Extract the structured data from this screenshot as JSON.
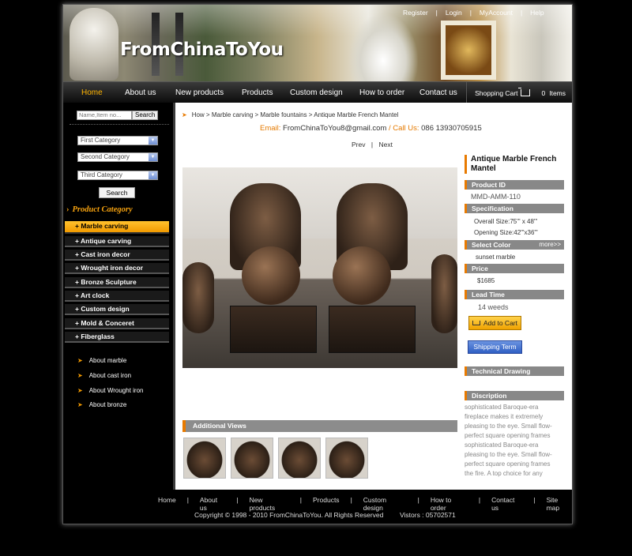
{
  "header": {
    "logo": "FromChinaToYou",
    "top_links": [
      "Register",
      "Login",
      "MyAccount",
      "Help"
    ]
  },
  "nav": {
    "items": [
      "Home",
      "About us",
      "New products",
      "Products",
      "Custom design",
      "How to order",
      "Contact us"
    ],
    "active": "Home",
    "cart_label": "Shopping Cart",
    "cart_count": "0",
    "cart_items_label": "Items"
  },
  "sidebar": {
    "search_placeholder": "Name,Item no...",
    "search_button": "Search",
    "selects": [
      "First Category",
      "Second Category",
      "Third Category"
    ],
    "search_button2": "Search",
    "category_title": "Product Category",
    "categories": [
      "Marble carving",
      "Antique carving",
      "Cast iron decor",
      "Wrought iron decor",
      "Bronze Sculpture",
      "Art clock",
      "Custom design",
      "Mold & Conceret",
      "Fiberglass"
    ],
    "about_links": [
      "About marble",
      "About cast iron",
      "About Wrought iron",
      "About bronze"
    ]
  },
  "main": {
    "breadcrumb": "How > Marble carving > Marble fountains > Antique Marble French Mantel",
    "email_label": "Email:",
    "email": "FromChinaToYou8@gmail.com",
    "slash": "/",
    "phone_label": "Call Us:",
    "phone": "086  13930705915",
    "prev": "Prev",
    "pager_sep": "|",
    "next": "Next",
    "additional_views": "Additional Views"
  },
  "product": {
    "title": "Antique Marble French Mantel",
    "id_label": "Product ID",
    "id": "MMD-AMM-110",
    "spec_label": "Specification",
    "overall_size": "Overall Size:75\"' x 48\"'",
    "opening_size": "Opening Size:42\"'x36\"'",
    "color_label": "Select Color",
    "more": "more>>",
    "color": "sunset marble",
    "price_label": "Price",
    "price": "$1685",
    "lead_label": "Lead Time",
    "lead": "14 weeds",
    "add_to_cart": "Add to Cart",
    "shipping": "Shipping Term",
    "tech_drawing": "Technical Drawing",
    "desc_label": "Discription",
    "description_lines": [
      "sophisticated Baroque-era",
      "fireplace makes it extremely",
      "pleasing to the eye. Small flow-",
      "perfect square opening frames",
      "sophisticated Baroque-era",
      "pleasing to the eye. Small flow-",
      "perfect square opening frames",
      "the fire. A top choice for any"
    ]
  },
  "footer": {
    "links": [
      "Home",
      "About us",
      "New products",
      "Products",
      "Custom design",
      "How to order",
      "Contact us",
      "Site map"
    ],
    "copyright": "Copyright © 1998 - 2010 FromChinaToYou. All Rights Reserved",
    "visitors": "Vistors : 05702571"
  },
  "colors": {
    "accent": "#e87a00",
    "active_cat": "#f6a20f",
    "ship_btn": "#2f5fc4",
    "background": "#000000"
  }
}
